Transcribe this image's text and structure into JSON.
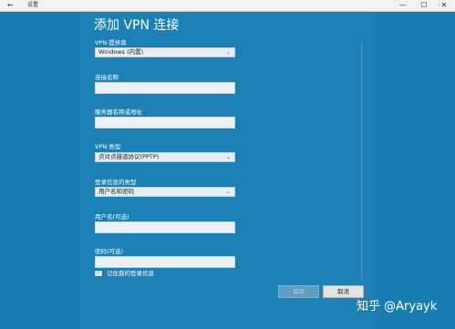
{
  "window": {
    "back_glyph": "←",
    "app_title": "设置",
    "minimize": "—",
    "maximize": "☐",
    "close": "✕"
  },
  "dialog": {
    "title": "添加 VPN 连接",
    "provider_label": "VPN 提供商",
    "provider_value": "Windows (内置)",
    "connection_name_label": "连接名称",
    "connection_name_value": "",
    "server_label": "服务器名称或地址",
    "server_value": "",
    "vpn_type_label": "VPN 类型",
    "vpn_type_value": "点对点隧道协议(PPTP)",
    "signin_type_label": "登录信息的类型",
    "signin_type_value": "用户名和密码",
    "username_label": "用户名(可选)",
    "username_value": "",
    "password_label": "密码(可选)",
    "password_value": "",
    "remember_label": "记住我的登录信息",
    "remember_checked": true,
    "save_label": "保存",
    "cancel_label": "取消"
  },
  "watermark": "知乎 @Aryayk",
  "colors": {
    "background": "#1a7db2",
    "titlebar": "#f2f2f2"
  }
}
